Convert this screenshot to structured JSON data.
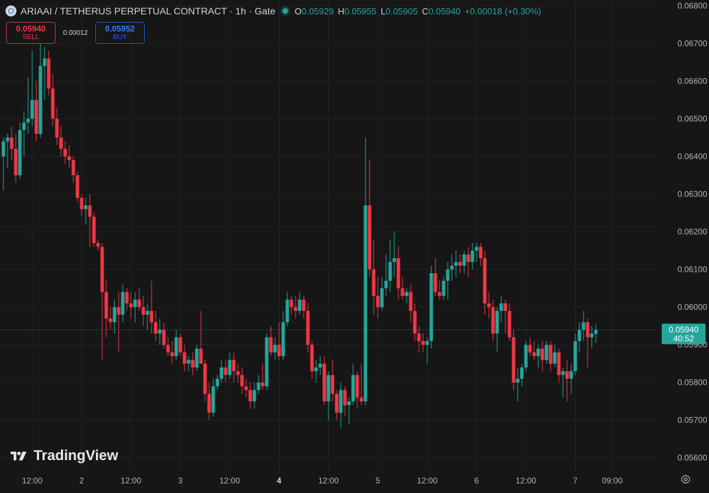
{
  "header": {
    "symbol_title": "ARIAAI / TETHERUS PERPETUAL CONTRACT · 1h · Gate",
    "open_label": "O",
    "open": "0.05929",
    "high_label": "H",
    "high": "0.05955",
    "low_label": "L",
    "low": "0.05905",
    "close_label": "C",
    "close": "0.05940",
    "change": "+0.00018 (+0.30%)"
  },
  "trade": {
    "sell_price": "0.05940",
    "sell_label": "SELL",
    "spread": "0.00012",
    "buy_price": "0.05952",
    "buy_label": "BUY"
  },
  "branding": {
    "name": "TradingView"
  },
  "icons": {
    "settings": "gear-icon",
    "logo": "tradingview-logo-icon",
    "symbol": "ariaai-coin-icon"
  },
  "colors": {
    "up": "#26a69a",
    "down": "#f23645",
    "background": "#161616",
    "grid": "#222222"
  },
  "chart_data": {
    "type": "candlestick",
    "timeframe": "1h",
    "y_ticks": [
      "0.05600",
      "0.05700",
      "0.05800",
      "0.05900",
      "0.06000",
      "0.06100",
      "0.06200",
      "0.06300",
      "0.06400",
      "0.06500",
      "0.06600",
      "0.06700",
      "0.06800"
    ],
    "ylim": [
      0.05565,
      0.06815
    ],
    "x_ticks": [
      {
        "label": "12:00",
        "index": 7,
        "bold": false
      },
      {
        "label": "2",
        "index": 19,
        "bold": false
      },
      {
        "label": "12:00",
        "index": 31,
        "bold": false
      },
      {
        "label": "3",
        "index": 43,
        "bold": false
      },
      {
        "label": "12:00",
        "index": 55,
        "bold": false
      },
      {
        "label": "4",
        "index": 67,
        "bold": true
      },
      {
        "label": "12:00",
        "index": 79,
        "bold": false
      },
      {
        "label": "5",
        "index": 91,
        "bold": false
      },
      {
        "label": "12:00",
        "index": 103,
        "bold": false
      },
      {
        "label": "6",
        "index": 115,
        "bold": false
      },
      {
        "label": "12:00",
        "index": 127,
        "bold": false
      },
      {
        "label": "7",
        "index": 139,
        "bold": false
      },
      {
        "label": "09:00",
        "index": 148,
        "bold": false
      }
    ],
    "current_price": "0.05940",
    "countdown": "40:52",
    "candles": [
      [
        0.064,
        0.0645,
        0.0631,
        0.0644
      ],
      [
        0.0644,
        0.0646,
        0.0637,
        0.0645
      ],
      [
        0.0645,
        0.0648,
        0.0639,
        0.0642
      ],
      [
        0.0642,
        0.0646,
        0.0633,
        0.0635
      ],
      [
        0.0635,
        0.0649,
        0.0634,
        0.0647
      ],
      [
        0.0647,
        0.0652,
        0.064,
        0.0649
      ],
      [
        0.0649,
        0.0661,
        0.0646,
        0.065
      ],
      [
        0.065,
        0.0668,
        0.0648,
        0.0655
      ],
      [
        0.0655,
        0.066,
        0.0644,
        0.0646
      ],
      [
        0.0646,
        0.067,
        0.0645,
        0.0664
      ],
      [
        0.0664,
        0.0669,
        0.0655,
        0.0666
      ],
      [
        0.0666,
        0.0668,
        0.0656,
        0.0658
      ],
      [
        0.0658,
        0.0662,
        0.0648,
        0.065
      ],
      [
        0.065,
        0.0653,
        0.0643,
        0.0645
      ],
      [
        0.0645,
        0.0648,
        0.064,
        0.0642
      ],
      [
        0.0642,
        0.0644,
        0.0638,
        0.064
      ],
      [
        0.064,
        0.0643,
        0.0637,
        0.0639
      ],
      [
        0.0639,
        0.064,
        0.0633,
        0.0635
      ],
      [
        0.0635,
        0.0636,
        0.0628,
        0.0629
      ],
      [
        0.0629,
        0.063,
        0.0624,
        0.0626
      ],
      [
        0.0626,
        0.0629,
        0.0622,
        0.0627
      ],
      [
        0.0627,
        0.063,
        0.0616,
        0.0624
      ],
      [
        0.0624,
        0.0625,
        0.0616,
        0.0617
      ],
      [
        0.0617,
        0.0618,
        0.0615,
        0.0616
      ],
      [
        0.0616,
        0.0617,
        0.0586,
        0.0604
      ],
      [
        0.0604,
        0.0607,
        0.0592,
        0.0597
      ],
      [
        0.0597,
        0.06,
        0.0594,
        0.0596
      ],
      [
        0.0596,
        0.0602,
        0.0593,
        0.06
      ],
      [
        0.06,
        0.0604,
        0.0588,
        0.0598
      ],
      [
        0.0598,
        0.0606,
        0.0596,
        0.0604
      ],
      [
        0.0604,
        0.0605,
        0.0599,
        0.0601
      ],
      [
        0.0601,
        0.0604,
        0.0597,
        0.06
      ],
      [
        0.06,
        0.0604,
        0.0596,
        0.0602
      ],
      [
        0.0602,
        0.0605,
        0.0599,
        0.06
      ],
      [
        0.06,
        0.0603,
        0.0595,
        0.0598
      ],
      [
        0.0598,
        0.0601,
        0.0594,
        0.0599
      ],
      [
        0.0599,
        0.0607,
        0.0593,
        0.0596
      ],
      [
        0.0596,
        0.0599,
        0.0591,
        0.0593
      ],
      [
        0.0593,
        0.0597,
        0.059,
        0.0594
      ],
      [
        0.0594,
        0.0596,
        0.0589,
        0.059
      ],
      [
        0.059,
        0.0592,
        0.0587,
        0.0588
      ],
      [
        0.0588,
        0.0591,
        0.0585,
        0.0587
      ],
      [
        0.0587,
        0.0594,
        0.0586,
        0.0592
      ],
      [
        0.0592,
        0.0593,
        0.0587,
        0.0588
      ],
      [
        0.0588,
        0.059,
        0.0583,
        0.0585
      ],
      [
        0.0585,
        0.0587,
        0.0583,
        0.0586
      ],
      [
        0.0586,
        0.0588,
        0.0582,
        0.0584
      ],
      [
        0.0584,
        0.059,
        0.0583,
        0.0589
      ],
      [
        0.0589,
        0.0599,
        0.0587,
        0.0585
      ],
      [
        0.0585,
        0.0586,
        0.0575,
        0.0577
      ],
      [
        0.0577,
        0.058,
        0.057,
        0.0572
      ],
      [
        0.0572,
        0.0581,
        0.0571,
        0.0579
      ],
      [
        0.0579,
        0.0582,
        0.0578,
        0.0581
      ],
      [
        0.0581,
        0.0586,
        0.058,
        0.0584
      ],
      [
        0.0584,
        0.0586,
        0.058,
        0.0582
      ],
      [
        0.0582,
        0.0588,
        0.0581,
        0.0586
      ],
      [
        0.0586,
        0.0588,
        0.058,
        0.0583
      ],
      [
        0.0583,
        0.0585,
        0.058,
        0.0582
      ],
      [
        0.0582,
        0.0584,
        0.0577,
        0.0579
      ],
      [
        0.0579,
        0.0581,
        0.0576,
        0.0578
      ],
      [
        0.0578,
        0.058,
        0.0573,
        0.0575
      ],
      [
        0.0575,
        0.058,
        0.0573,
        0.0578
      ],
      [
        0.0578,
        0.0582,
        0.0577,
        0.058
      ],
      [
        0.058,
        0.0585,
        0.0578,
        0.0579
      ],
      [
        0.0579,
        0.0593,
        0.0578,
        0.0592
      ],
      [
        0.0592,
        0.0595,
        0.0587,
        0.0588
      ],
      [
        0.0588,
        0.0592,
        0.0586,
        0.059
      ],
      [
        0.059,
        0.0596,
        0.0586,
        0.0587
      ],
      [
        0.0587,
        0.0599,
        0.0586,
        0.0596
      ],
      [
        0.0596,
        0.0604,
        0.0595,
        0.0602
      ],
      [
        0.0602,
        0.0603,
        0.0598,
        0.06
      ],
      [
        0.06,
        0.0603,
        0.0597,
        0.0599
      ],
      [
        0.0599,
        0.0604,
        0.0598,
        0.0602
      ],
      [
        0.0602,
        0.0603,
        0.0597,
        0.0599
      ],
      [
        0.0599,
        0.0601,
        0.0588,
        0.059
      ],
      [
        0.059,
        0.0591,
        0.0581,
        0.0583
      ],
      [
        0.0583,
        0.0586,
        0.058,
        0.0584
      ],
      [
        0.0584,
        0.0587,
        0.0582,
        0.0585
      ],
      [
        0.0585,
        0.0587,
        0.0574,
        0.0575
      ],
      [
        0.0575,
        0.0583,
        0.057,
        0.0582
      ],
      [
        0.0582,
        0.0586,
        0.0575,
        0.0577
      ],
      [
        0.0577,
        0.0578,
        0.057,
        0.0572
      ],
      [
        0.0572,
        0.058,
        0.0568,
        0.0578
      ],
      [
        0.0578,
        0.0579,
        0.0571,
        0.0574
      ],
      [
        0.0574,
        0.0576,
        0.0569,
        0.0575
      ],
      [
        0.0575,
        0.0585,
        0.0574,
        0.0582
      ],
      [
        0.0582,
        0.0583,
        0.0573,
        0.0576
      ],
      [
        0.0576,
        0.0585,
        0.0574,
        0.0575
      ],
      [
        0.0575,
        0.0645,
        0.0574,
        0.0627
      ],
      [
        0.0627,
        0.0639,
        0.0608,
        0.061
      ],
      [
        0.061,
        0.0618,
        0.0598,
        0.0603
      ],
      [
        0.0603,
        0.0608,
        0.0597,
        0.06
      ],
      [
        0.06,
        0.0608,
        0.0599,
        0.0605
      ],
      [
        0.0605,
        0.0614,
        0.0603,
        0.0607
      ],
      [
        0.0607,
        0.0618,
        0.0604,
        0.0612
      ],
      [
        0.0612,
        0.062,
        0.0608,
        0.0613
      ],
      [
        0.0613,
        0.0616,
        0.0602,
        0.0605
      ],
      [
        0.0605,
        0.0608,
        0.0602,
        0.0603
      ],
      [
        0.0603,
        0.0605,
        0.0601,
        0.0604
      ],
      [
        0.0604,
        0.0606,
        0.0596,
        0.0599
      ],
      [
        0.0599,
        0.0601,
        0.0591,
        0.0593
      ],
      [
        0.0593,
        0.0595,
        0.0588,
        0.0591
      ],
      [
        0.0591,
        0.0593,
        0.0588,
        0.059
      ],
      [
        0.059,
        0.0592,
        0.0585,
        0.0591
      ],
      [
        0.0591,
        0.0611,
        0.0589,
        0.0609
      ],
      [
        0.0609,
        0.0613,
        0.0603,
        0.0604
      ],
      [
        0.0604,
        0.0607,
        0.0602,
        0.0603
      ],
      [
        0.0603,
        0.0608,
        0.0602,
        0.0607
      ],
      [
        0.0607,
        0.0612,
        0.0602,
        0.061
      ],
      [
        0.061,
        0.0614,
        0.0607,
        0.0611
      ],
      [
        0.0611,
        0.0615,
        0.0608,
        0.0612
      ],
      [
        0.0612,
        0.0614,
        0.0609,
        0.0611
      ],
      [
        0.0611,
        0.0615,
        0.0609,
        0.0614
      ],
      [
        0.0614,
        0.0616,
        0.0608,
        0.0612
      ],
      [
        0.0612,
        0.0617,
        0.061,
        0.0615
      ],
      [
        0.0615,
        0.0617,
        0.0612,
        0.0616
      ],
      [
        0.0616,
        0.0617,
        0.0611,
        0.0613
      ],
      [
        0.0613,
        0.0615,
        0.0598,
        0.0601
      ],
      [
        0.0601,
        0.0604,
        0.0597,
        0.06
      ],
      [
        0.06,
        0.0602,
        0.0591,
        0.0593
      ],
      [
        0.0593,
        0.06,
        0.0588,
        0.0599
      ],
      [
        0.0599,
        0.0603,
        0.0596,
        0.0601
      ],
      [
        0.0601,
        0.0602,
        0.0593,
        0.0599
      ],
      [
        0.0599,
        0.0601,
        0.0591,
        0.0592
      ],
      [
        0.0592,
        0.0594,
        0.0578,
        0.058
      ],
      [
        0.058,
        0.0584,
        0.0575,
        0.0581
      ],
      [
        0.0581,
        0.0585,
        0.0579,
        0.0584
      ],
      [
        0.0584,
        0.0591,
        0.0583,
        0.059
      ],
      [
        0.059,
        0.0592,
        0.0587,
        0.0588
      ],
      [
        0.0588,
        0.0591,
        0.0586,
        0.0587
      ],
      [
        0.0587,
        0.059,
        0.0584,
        0.0589
      ],
      [
        0.0589,
        0.0591,
        0.0583,
        0.0586
      ],
      [
        0.0586,
        0.0591,
        0.0585,
        0.059
      ],
      [
        0.059,
        0.0591,
        0.0583,
        0.0585
      ],
      [
        0.0585,
        0.059,
        0.0584,
        0.0588
      ],
      [
        0.0588,
        0.0589,
        0.058,
        0.0582
      ],
      [
        0.0582,
        0.0584,
        0.0576,
        0.0583
      ],
      [
        0.0583,
        0.0586,
        0.0575,
        0.0581
      ],
      [
        0.0581,
        0.0585,
        0.0577,
        0.0583
      ],
      [
        0.0583,
        0.0593,
        0.0582,
        0.0591
      ],
      [
        0.0591,
        0.0596,
        0.0588,
        0.0594
      ],
      [
        0.0594,
        0.0599,
        0.0591,
        0.0596
      ],
      [
        0.0596,
        0.0597,
        0.0584,
        0.0592
      ],
      [
        0.0592,
        0.0595,
        0.0589,
        0.0593
      ],
      [
        0.05929,
        0.05955,
        0.05905,
        0.0594
      ]
    ]
  }
}
